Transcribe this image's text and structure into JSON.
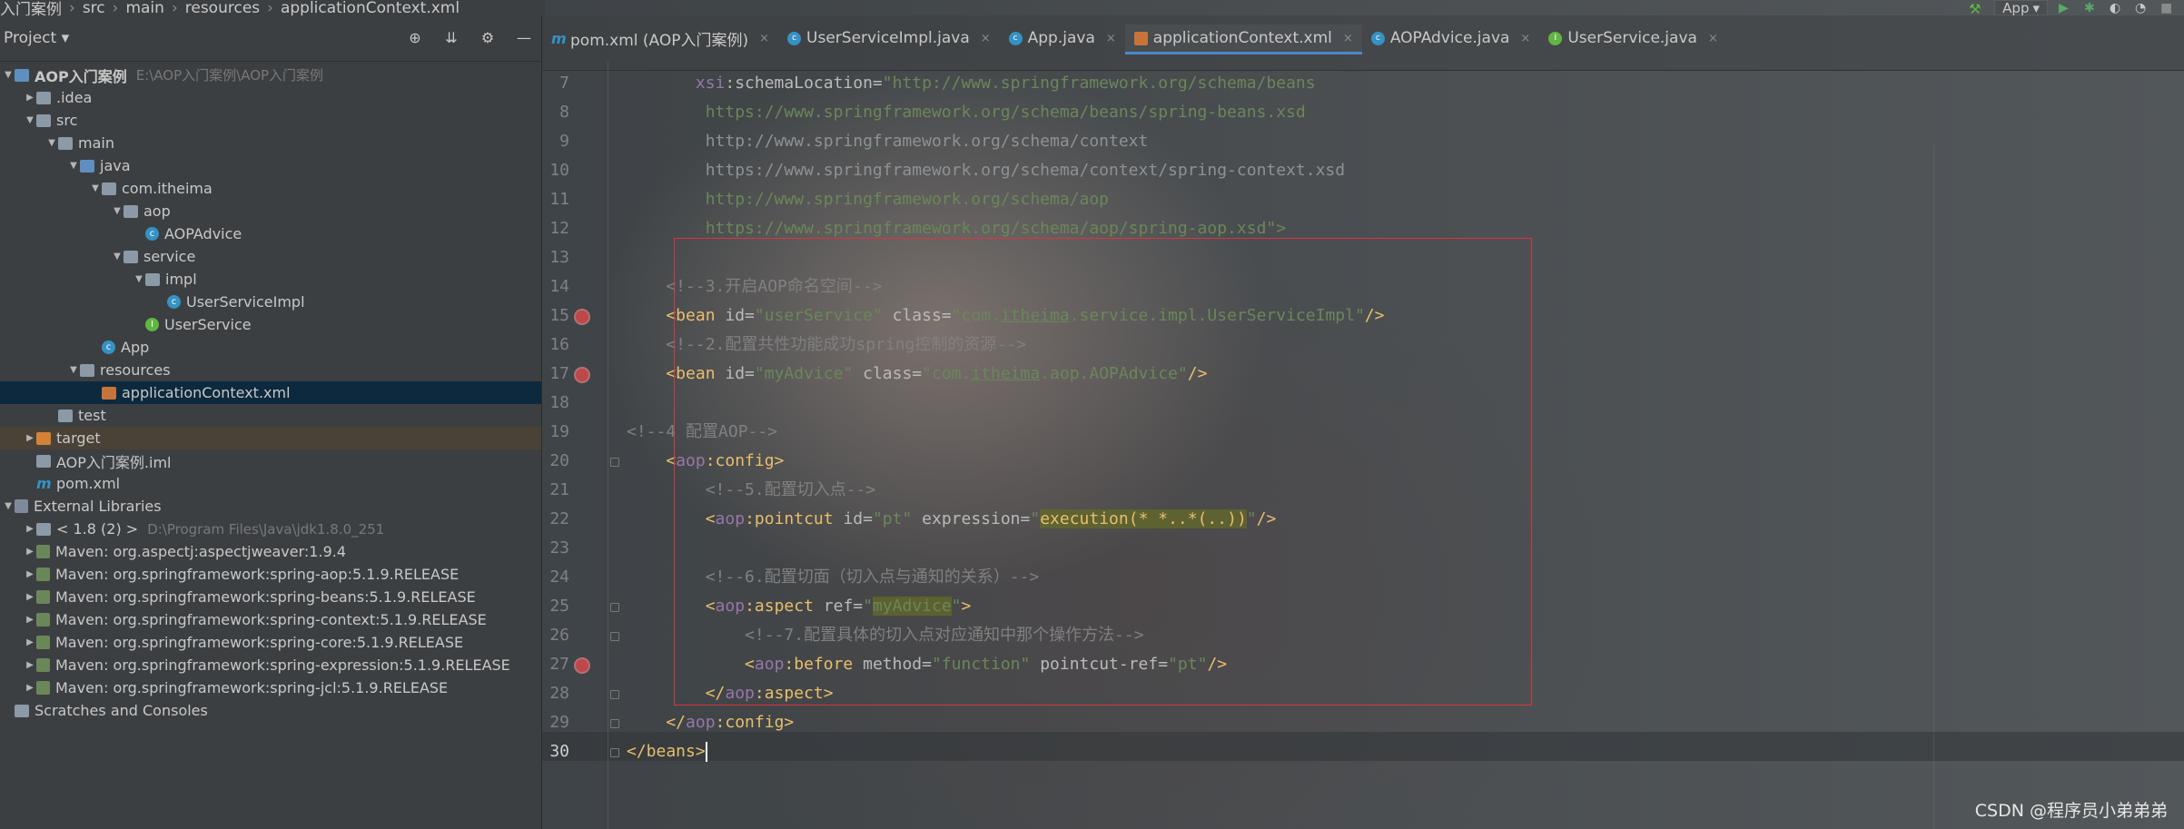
{
  "breadcrumb": [
    "入门案例",
    "src",
    "main",
    "resources",
    "applicationContext.xml"
  ],
  "run_config": "App",
  "project_panel": {
    "title": "Project",
    "tree": [
      {
        "indent": 0,
        "arrow": "▼",
        "icon": "folder-blue",
        "label": "AOP入门案例",
        "path": "E:\\AOP入门案例\\AOP入门案例",
        "bold": true
      },
      {
        "indent": 1,
        "arrow": "▶",
        "icon": "folder",
        "label": ".idea"
      },
      {
        "indent": 1,
        "arrow": "▼",
        "icon": "folder",
        "label": "src"
      },
      {
        "indent": 2,
        "arrow": "▼",
        "icon": "folder",
        "label": "main"
      },
      {
        "indent": 3,
        "arrow": "▼",
        "icon": "folder-blue",
        "label": "java"
      },
      {
        "indent": 4,
        "arrow": "▼",
        "icon": "folder-pkg",
        "label": "com.itheima"
      },
      {
        "indent": 5,
        "arrow": "▼",
        "icon": "folder-pkg",
        "label": "aop"
      },
      {
        "indent": 6,
        "arrow": "",
        "icon": "class",
        "label": "AOPAdvice"
      },
      {
        "indent": 5,
        "arrow": "▼",
        "icon": "folder-pkg",
        "label": "service"
      },
      {
        "indent": 6,
        "arrow": "▼",
        "icon": "folder-pkg",
        "label": "impl"
      },
      {
        "indent": 7,
        "arrow": "",
        "icon": "class",
        "label": "UserServiceImpl"
      },
      {
        "indent": 6,
        "arrow": "",
        "icon": "iface",
        "label": "UserService"
      },
      {
        "indent": 4,
        "arrow": "",
        "icon": "class",
        "label": "App"
      },
      {
        "indent": 3,
        "arrow": "▼",
        "icon": "folder-res",
        "label": "resources"
      },
      {
        "indent": 4,
        "arrow": "",
        "icon": "xml",
        "label": "applicationContext.xml",
        "selected": true
      },
      {
        "indent": 2,
        "arrow": "",
        "icon": "folder",
        "label": "test"
      },
      {
        "indent": 1,
        "arrow": "▶",
        "icon": "folder-orange",
        "label": "target",
        "target": true
      },
      {
        "indent": 1,
        "arrow": "",
        "icon": "iml",
        "label": "AOP入门案例.iml"
      },
      {
        "indent": 1,
        "arrow": "",
        "icon": "m",
        "label": "pom.xml"
      },
      {
        "indent": 0,
        "arrow": "▼",
        "icon": "lib",
        "label": "External Libraries"
      },
      {
        "indent": 1,
        "arrow": "▶",
        "icon": "folder",
        "label": "< 1.8 (2) >",
        "path": "D:\\Program Files\\Java\\jdk1.8.0_251"
      },
      {
        "indent": 1,
        "arrow": "▶",
        "icon": "maven",
        "label": "Maven: org.aspectj:aspectjweaver:1.9.4"
      },
      {
        "indent": 1,
        "arrow": "▶",
        "icon": "maven",
        "label": "Maven: org.springframework:spring-aop:5.1.9.RELEASE"
      },
      {
        "indent": 1,
        "arrow": "▶",
        "icon": "maven",
        "label": "Maven: org.springframework:spring-beans:5.1.9.RELEASE"
      },
      {
        "indent": 1,
        "arrow": "▶",
        "icon": "maven",
        "label": "Maven: org.springframework:spring-context:5.1.9.RELEASE"
      },
      {
        "indent": 1,
        "arrow": "▶",
        "icon": "maven",
        "label": "Maven: org.springframework:spring-core:5.1.9.RELEASE"
      },
      {
        "indent": 1,
        "arrow": "▶",
        "icon": "maven",
        "label": "Maven: org.springframework:spring-expression:5.1.9.RELEASE"
      },
      {
        "indent": 1,
        "arrow": "▶",
        "icon": "maven",
        "label": "Maven: org.springframework:spring-jcl:5.1.9.RELEASE"
      },
      {
        "indent": 0,
        "arrow": "",
        "icon": "folder",
        "label": "Scratches and Consoles"
      }
    ]
  },
  "tabs": [
    {
      "icon": "m",
      "label": "pom.xml (AOP入门案例)"
    },
    {
      "icon": "c",
      "label": "UserServiceImpl.java"
    },
    {
      "icon": "c",
      "label": "App.java"
    },
    {
      "icon": "x1",
      "label": "applicationContext.xml",
      "active": true
    },
    {
      "icon": "c",
      "label": "AOPAdvice.java"
    },
    {
      "icon": "i",
      "label": "UserService.java"
    }
  ],
  "editor": {
    "line_numbers": [
      "7",
      "8",
      "9",
      "10",
      "11",
      "12",
      "13",
      "14",
      "15",
      "16",
      "17",
      "18",
      "19",
      "20",
      "21",
      "22",
      "23",
      "24",
      "25",
      "26",
      "27",
      "28",
      "29",
      "30"
    ],
    "current_line": "30",
    "lines": [
      [
        {
          "t": "       xsi",
          "c": "ns"
        },
        {
          "t": ":schemaLocation=",
          "c": "attr"
        },
        {
          "t": "\"http://www.springframework.org/schema/beans",
          "c": "str"
        }
      ],
      [
        {
          "t": "        https://www.springframework.org/schema/beans/spring-beans.xsd",
          "c": "url"
        }
      ],
      [
        {
          "t": "        http://www.springframework.org/schema/context",
          "c": "url-dim"
        }
      ],
      [
        {
          "t": "        https://www.springframework.org/schema/context/spring-context.xsd",
          "c": "url-dim"
        }
      ],
      [
        {
          "t": "        http://www.springframework.org/schema/aop",
          "c": "url"
        }
      ],
      [
        {
          "t": "        https://www.springframework.org/schema/aop/spring-aop.xsd\">",
          "c": "url"
        }
      ],
      [],
      [
        {
          "t": "    <!--3.开启AOP命名空间-->",
          "c": "cmt"
        }
      ],
      [
        {
          "t": "    <bean ",
          "c": "tag"
        },
        {
          "t": "id=",
          "c": "attr"
        },
        {
          "t": "\"userService\" ",
          "c": "str"
        },
        {
          "t": "class=",
          "c": "attr"
        },
        {
          "t": "\"com.",
          "c": "str"
        },
        {
          "t": "itheima",
          "c": "str u"
        },
        {
          "t": ".service.impl.UserServiceImpl\"",
          "c": "str"
        },
        {
          "t": "/>",
          "c": "tag"
        }
      ],
      [
        {
          "t": "    <!--2.配置共性功能成功spring控制的资源-->",
          "c": "cmt"
        }
      ],
      [
        {
          "t": "    <bean ",
          "c": "tag"
        },
        {
          "t": "id=",
          "c": "attr"
        },
        {
          "t": "\"myAdvice\" ",
          "c": "str"
        },
        {
          "t": "class=",
          "c": "attr"
        },
        {
          "t": "\"com.",
          "c": "str"
        },
        {
          "t": "itheima",
          "c": "str u"
        },
        {
          "t": ".aop.AOPAdvice\"",
          "c": "str"
        },
        {
          "t": "/>",
          "c": "tag"
        }
      ],
      [],
      [
        {
          "t": "<!--4 配置AOP-->",
          "c": "cmt"
        }
      ],
      [
        {
          "t": "    <",
          "c": "tag"
        },
        {
          "t": "aop",
          "c": "ns"
        },
        {
          "t": ":config>",
          "c": "tag"
        }
      ],
      [
        {
          "t": "        <!--5.配置切入点-->",
          "c": "cmt"
        }
      ],
      [
        {
          "t": "        <",
          "c": "tag"
        },
        {
          "t": "aop",
          "c": "ns"
        },
        {
          "t": ":pointcut ",
          "c": "tag"
        },
        {
          "t": "id=",
          "c": "attr"
        },
        {
          "t": "\"pt\" ",
          "c": "str"
        },
        {
          "t": "expression=",
          "c": "attr"
        },
        {
          "t": "\"",
          "c": "str"
        },
        {
          "t": "execution(* *..*(..))",
          "c": "tag hl"
        },
        {
          "t": "\"",
          "c": "str"
        },
        {
          "t": "/>",
          "c": "tag"
        }
      ],
      [],
      [
        {
          "t": "        <!--6.配置切面（切入点与通知的关系）-->",
          "c": "cmt"
        }
      ],
      [
        {
          "t": "        <",
          "c": "tag"
        },
        {
          "t": "aop",
          "c": "ns"
        },
        {
          "t": ":aspect ",
          "c": "tag"
        },
        {
          "t": "ref=",
          "c": "attr"
        },
        {
          "t": "\"",
          "c": "str"
        },
        {
          "t": "myAdvice",
          "c": "str hl"
        },
        {
          "t": "\"",
          "c": "str"
        },
        {
          "t": ">",
          "c": "tag"
        }
      ],
      [
        {
          "t": "            <!--7.配置具体的切入点对应通知中那个操作方法-->",
          "c": "cmt"
        }
      ],
      [
        {
          "t": "            <",
          "c": "tag"
        },
        {
          "t": "aop",
          "c": "ns"
        },
        {
          "t": ":before ",
          "c": "tag"
        },
        {
          "t": "method=",
          "c": "attr"
        },
        {
          "t": "\"function\" ",
          "c": "str"
        },
        {
          "t": "pointcut-ref=",
          "c": "attr"
        },
        {
          "t": "\"pt\"",
          "c": "str"
        },
        {
          "t": "/>",
          "c": "tag"
        }
      ],
      [
        {
          "t": "        </",
          "c": "tag"
        },
        {
          "t": "aop",
          "c": "ns"
        },
        {
          "t": ":aspect>",
          "c": "tag"
        }
      ],
      [
        {
          "t": "    </",
          "c": "tag"
        },
        {
          "t": "aop",
          "c": "ns"
        },
        {
          "t": ":config>",
          "c": "tag"
        }
      ],
      [
        {
          "t": "</beans>",
          "c": "tag"
        }
      ]
    ]
  },
  "watermark": "CSDN @程序员小弟弟弟"
}
